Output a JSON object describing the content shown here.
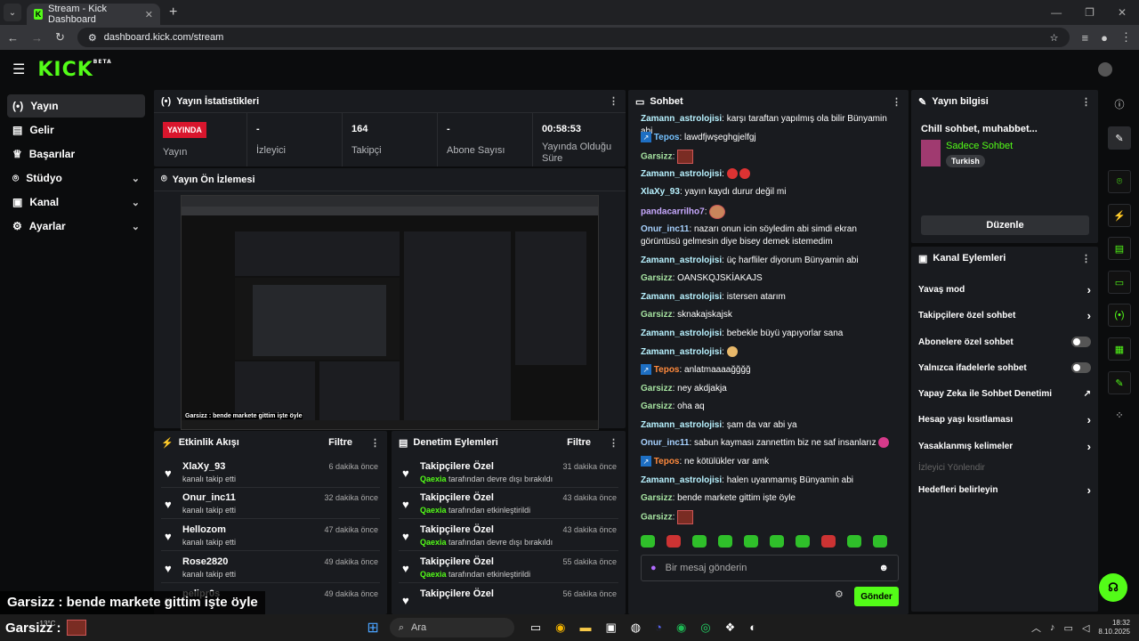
{
  "browser": {
    "tab_title": "Stream - Kick Dashboard",
    "url": "dashboard.kick.com/stream"
  },
  "header": {
    "logo": "KICK",
    "beta": "BETA"
  },
  "sidebar": {
    "items": [
      {
        "label": "Yayın",
        "icon": "broadcast-icon"
      },
      {
        "label": "Gelir",
        "icon": "chart-icon"
      },
      {
        "label": "Başarılar",
        "icon": "trophy-icon"
      },
      {
        "label": "Stüdyo",
        "icon": "studio-icon"
      },
      {
        "label": "Kanal",
        "icon": "channel-icon"
      },
      {
        "label": "Ayarlar",
        "icon": "gear-icon"
      }
    ]
  },
  "stats": {
    "title": "Yayın İstatistikleri",
    "live": "YAYINDA",
    "live_label": "Yayın",
    "viewers_val": "-",
    "viewers": "İzleyici",
    "followers_val": "164",
    "followers": "Takipçi",
    "subs_val": "-",
    "subs": "Abone Sayısı",
    "uptime_val": "00:58:53",
    "uptime": "Yayında Olduğu Süre"
  },
  "preview": {
    "title": "Yayın Ön İzlemesi",
    "caption": "Garsizz : bende markete gittim işte öyle"
  },
  "activity": {
    "title": "Etkinlik Akışı",
    "filter": "Filtre",
    "rows": [
      {
        "name": "XlaXy_93",
        "sub": "kanalı takip etti",
        "time": "6 dakika önce"
      },
      {
        "name": "Onur_inc11",
        "sub": "kanalı takip etti",
        "time": "32 dakika önce"
      },
      {
        "name": "Hellozom",
        "sub": "kanalı takip etti",
        "time": "47 dakika önce"
      },
      {
        "name": "Rose2820",
        "sub": "kanalı takip etti",
        "time": "49 dakika önce"
      },
      {
        "name": "pelipr0s",
        "sub": "",
        "time": "49 dakika önce"
      }
    ]
  },
  "moderation": {
    "title": "Denetim Eylemleri",
    "filter": "Filtre",
    "rows": [
      {
        "name": "Takipçilere Özel",
        "user": "Qaexia",
        "sub": "tarafından devre dışı bırakıldı",
        "time": "31 dakika önce"
      },
      {
        "name": "Takipçilere Özel",
        "user": "Qaexia",
        "sub": "tarafından etkinleştirildi",
        "time": "43 dakika önce"
      },
      {
        "name": "Takipçilere Özel",
        "user": "Qaexia",
        "sub": "tarafından devre dışı bırakıldı",
        "time": "43 dakika önce"
      },
      {
        "name": "Takipçilere Özel",
        "user": "Qaexia",
        "sub": "tarafından etkinleştirildi",
        "time": "55 dakika önce"
      },
      {
        "name": "Takipçilere Özel",
        "user": "",
        "sub": "",
        "time": "56 dakika önce"
      }
    ]
  },
  "chat": {
    "title": "Sohbet",
    "messages": [
      {
        "user": "Zamann_astrolojisi",
        "text": ": karşı taraftan yapılmış ola bilir Bünyamin abi"
      },
      {
        "user": "Tepos",
        "text": ": lawdfjwşeghgjelfgj"
      },
      {
        "user": "Garsizz",
        "text": ":"
      },
      {
        "user": "Zamann_astrolojisi",
        "text": ":"
      },
      {
        "user": "XlaXy_93",
        "text": ": yayın kaydı durur değil mi"
      },
      {
        "user": "pandacarrilho7",
        "text": ":"
      },
      {
        "user": "Onur_inc11",
        "text": ": nazarı onun icin söyledim abi simdi ekran görüntüsü gelmesin diye bisey demek istemedim"
      },
      {
        "user": "Zamann_astrolojisi",
        "text": ": üç harfliler diyorum Bünyamin abi"
      },
      {
        "user": "Garsizz",
        "text": ": OANSKQJSKİAKAJS"
      },
      {
        "user": "Zamann_astrolojisi",
        "text": ": istersen atarım"
      },
      {
        "user": "Garsizz",
        "text": ": sknakajskajsk"
      },
      {
        "user": "Zamann_astrolojisi",
        "text": ": bebekle büyü yapıyorlar sana"
      },
      {
        "user": "Zamann_astrolojisi",
        "text": ":"
      },
      {
        "user": "Tepos",
        "text": ": anlatmaaaağğğğ"
      },
      {
        "user": "Garsizz",
        "text": ": ney akdjakja"
      },
      {
        "user": "Garsizz",
        "text": ": oha aq"
      },
      {
        "user": "Zamann_astrolojisi",
        "text": ": şam da var abi ya"
      },
      {
        "user": "Onur_inc11",
        "text": ": sabun kayması zannettim biz ne saf insanlarız"
      },
      {
        "user": "Tepos",
        "text": ": ne kötülükler var amk"
      },
      {
        "user": "Zamann_astrolojisi",
        "text": ": halen uyanmamış Bünyamin abi"
      },
      {
        "user": "Garsizz",
        "text": ": bende markete gittim işte öyle"
      },
      {
        "user": "Garsizz",
        "text": ":"
      }
    ],
    "placeholder": "Bir mesaj gönderin",
    "send": "Gönder"
  },
  "info": {
    "title": "Yayın bilgisi",
    "stream_title": "Chill sohbet, muhabbet...",
    "category": "Sadece Sohbet",
    "tag": "Turkish",
    "edit": "Düzenle"
  },
  "channel_actions": {
    "title": "Kanal Eylemleri",
    "items": [
      {
        "label": "Yavaş mod",
        "control": "arrow"
      },
      {
        "label": "Takipçilere özel sohbet",
        "control": "arrow"
      },
      {
        "label": "Abonelere özel sohbet",
        "control": "toggle"
      },
      {
        "label": "Yalnızca ifadelerle sohbet",
        "control": "toggle"
      },
      {
        "label": "Yapay Zeka ile Sohbet Denetimi",
        "control": "external"
      },
      {
        "label": "Hesap yaşı kısıtlaması",
        "control": "arrow"
      },
      {
        "label": "Yasaklanmış kelimeler",
        "control": "arrow"
      },
      {
        "label": "İzleyici Yönlendir",
        "control": "none"
      },
      {
        "label": "Hedefleri belirleyin",
        "control": "arrow"
      }
    ]
  },
  "overlay": {
    "line1": "Garsizz : bende markete gittim işte öyle",
    "line2": "Garsizz :"
  },
  "taskbar": {
    "weather": "13°C",
    "search": "Ara",
    "time": "18:32",
    "date": "8.10.2025"
  }
}
